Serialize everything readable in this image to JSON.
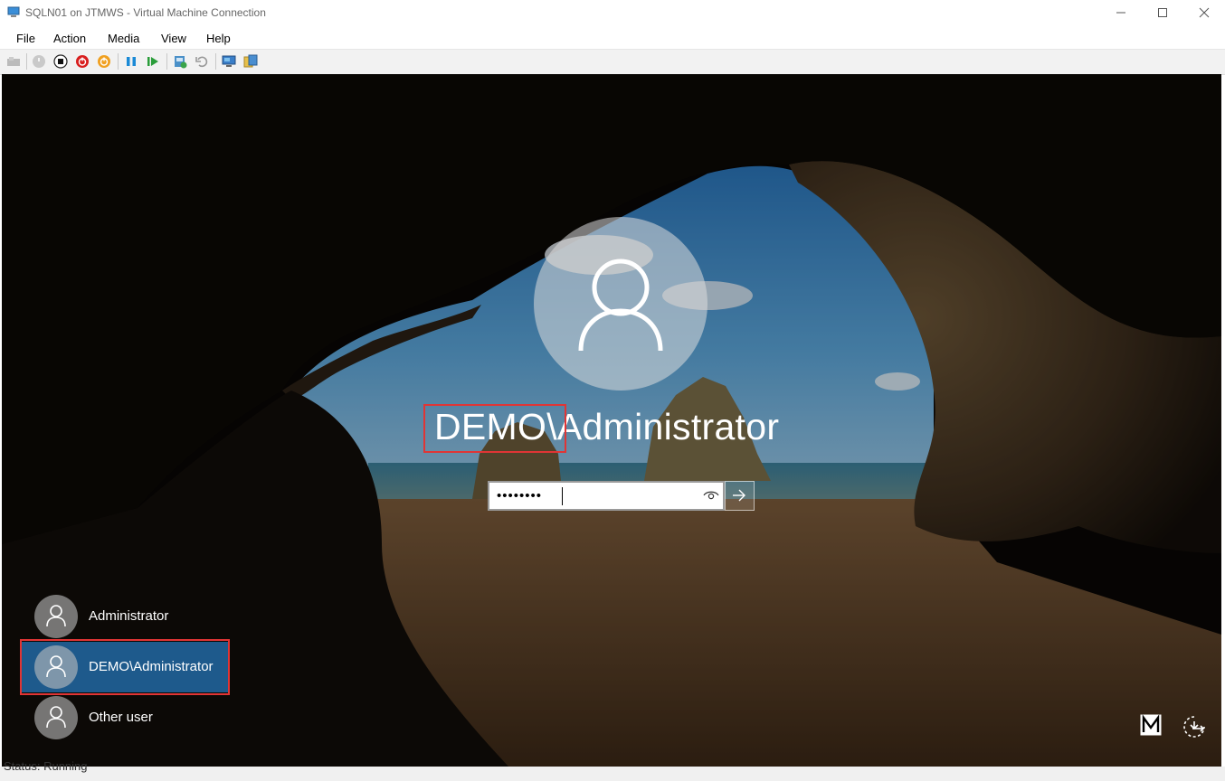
{
  "window": {
    "title": "SQLN01 on JTMWS - Virtual Machine Connection"
  },
  "menu": {
    "items": [
      "File",
      "Action",
      "Media",
      "View",
      "Help"
    ]
  },
  "toolbar": {
    "icons": [
      "ctrl-alt-del-icon",
      "start-icon",
      "turn-off-icon",
      "shut-down-icon",
      "save-state-icon",
      "pause-icon",
      "reset-icon",
      "checkpoint-icon",
      "revert-icon",
      "enhanced-session-icon",
      "share-icon"
    ]
  },
  "lock_screen": {
    "domain_user": "DEMO\\Administrator",
    "password_mask": "••••••••",
    "users": [
      "Administrator",
      "DEMO\\Administrator",
      "Other user"
    ],
    "selected_user": "DEMO\\Administrator",
    "accent_selected": "#1e5a8c",
    "highlight_color": "#e03535"
  },
  "status": {
    "text": "Status: Running"
  }
}
